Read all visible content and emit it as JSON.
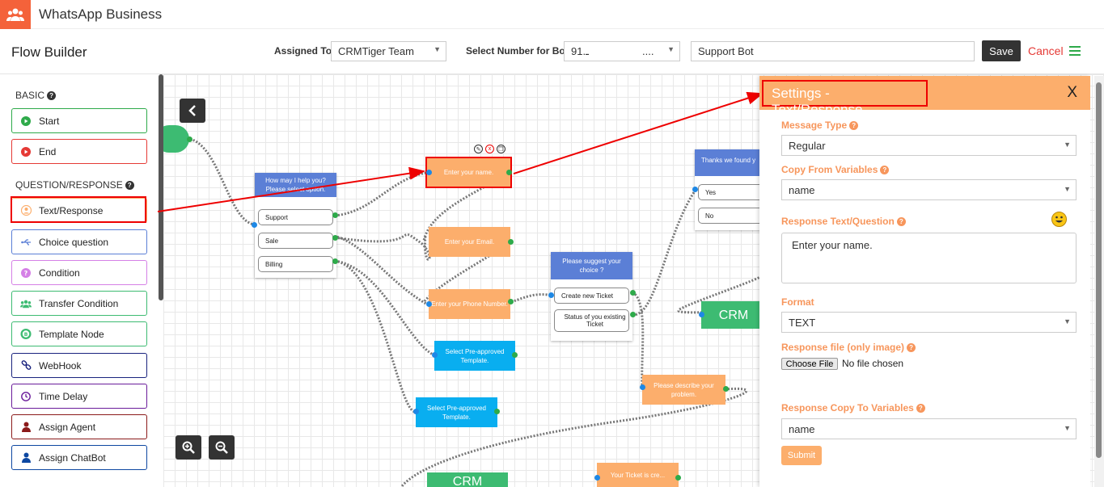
{
  "app": {
    "title": "WhatsApp Business"
  },
  "header": {
    "page_title": "Flow Builder",
    "assigned_to_label": "Assigned To",
    "assigned_to_value": "CRMTiger Team",
    "select_number_label": "Select Number for Bot",
    "select_number_value": "91.ـ",
    "select_number_suffix": "....",
    "bot_name_value": "Support Bot",
    "save_label": "Save",
    "cancel_label": "Cancel"
  },
  "sidebar": {
    "basic_label": "BASIC",
    "qr_label": "QUESTION/RESPONSE",
    "items": [
      {
        "label": "Start",
        "color": "#2eaa4a",
        "icon": "play-icon"
      },
      {
        "label": "End",
        "color": "#e53935",
        "icon": "stop-icon"
      },
      {
        "label": "Text/Response",
        "color": "#fcae6c",
        "icon": "user-circle-icon"
      },
      {
        "label": "Choice question",
        "color": "#5b7fd6",
        "icon": "usb-icon"
      },
      {
        "label": "Condition",
        "color": "#d580e6",
        "icon": "question-circle-icon"
      },
      {
        "label": "Transfer Condition",
        "color": "#3dbb72",
        "icon": "users-icon"
      },
      {
        "label": "Template Node",
        "color": "#3dbb72",
        "icon": "template-icon"
      },
      {
        "label": "WebHook",
        "color": "#1a237e",
        "icon": "link-icon"
      },
      {
        "label": "Time Delay",
        "color": "#6a1b9a",
        "icon": "clock-icon"
      },
      {
        "label": "Assign Agent",
        "color": "#8b1a1a",
        "icon": "person-icon"
      },
      {
        "label": "Assign ChatBot",
        "color": "#0d47a1",
        "icon": "person-icon"
      }
    ]
  },
  "canvas": {
    "menu_node": {
      "header": "How may I help you? Please select option.",
      "options": [
        "Support",
        "Sale",
        "Billing"
      ]
    },
    "enter_name": "Enter your name.",
    "enter_email": "Enter your Email.",
    "enter_phone": "Enter your Phone Number.",
    "preapproved_1": "Select Pre-approved Template.",
    "preapproved_2": "Select Pre-approved Template.",
    "suggest_node": {
      "header": "Please suggest your choice ?",
      "options": [
        "Create new Ticket",
        "Status of you existing Ticket"
      ]
    },
    "describe_problem": "Please describe your problem.",
    "found_node": {
      "header": "Thanks we found y",
      "options": [
        "Yes",
        "No"
      ]
    },
    "crm_1": "CRM",
    "crm_2": "CRM",
    "ticket_created": "Your Ticket is cre..."
  },
  "panel": {
    "title": "Settings - Text/Response",
    "close_label": "X",
    "message_type_label": "Message Type",
    "message_type_value": "Regular",
    "copy_from_label": "Copy From Variables",
    "copy_from_value": "name",
    "response_text_label": "Response Text/Question",
    "response_text_value": "Enter your name.",
    "format_label": "Format",
    "format_value": "TEXT",
    "response_file_label": "Response file (only image)",
    "choose_file_label": "Choose File",
    "no_file_label": "No file chosen",
    "copy_to_label": "Response Copy To Variables",
    "copy_to_value": "name",
    "submit_label": "Submit"
  },
  "colors": {
    "accent": "#fcae6c",
    "brand": "#f4623a",
    "highlight": "#e00000"
  }
}
